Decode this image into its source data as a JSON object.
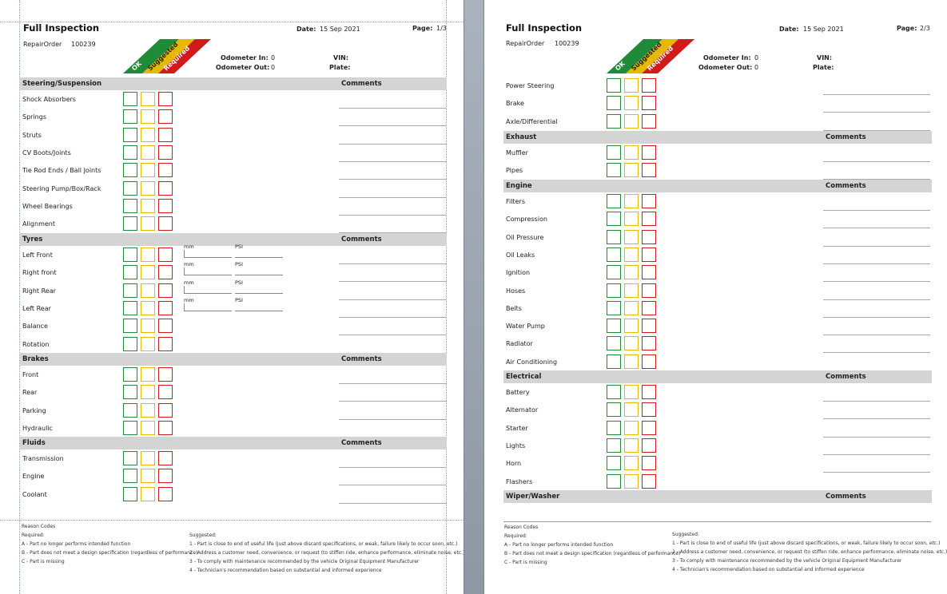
{
  "report": {
    "title": "Full Inspection",
    "repair_label": "RepairOrder",
    "repair_no": "100239",
    "date_label": "Date:",
    "date": "15 Sep 2021",
    "page_label": "Page:",
    "odo_in_label": "Odometer In:",
    "odo_in": "0",
    "odo_out_label": "Odometer Out:",
    "odo_out": "0",
    "vin_label": "VIN:",
    "plate_label": "Plate:",
    "legend": {
      "ok": "OK",
      "suggested": "Suggested",
      "required": "Required"
    },
    "comments_label": "Comments",
    "mm_label": "mm",
    "psi_label": "PSI"
  },
  "colors": {
    "ok": "#1f8a38",
    "suggested": "#e7b800",
    "required": "#d11a1a",
    "section_bg": "#d4d4d4"
  },
  "page1": {
    "page_no": "1/3",
    "sections": [
      {
        "name": "Steering/Suspension",
        "items": [
          "Shock Absorbers",
          "Springs",
          "Struts",
          "CV Boots/Joints",
          "Tie Rod Ends / Ball Joints",
          "Steering Pump/Box/Rack",
          "Wheel Bearings",
          "Alignment"
        ]
      },
      {
        "name": "Tyres",
        "items": [
          "Left Front",
          "Right front",
          "Right Rear",
          "Left Rear",
          "Balance",
          "Rotation"
        ]
      },
      {
        "name": "Brakes",
        "items": [
          "Front",
          "Rear",
          "Parking",
          "Hydraulic"
        ]
      },
      {
        "name": "Fluids",
        "items": [
          "Transmission",
          "Engine",
          "Coolant"
        ]
      }
    ]
  },
  "page2": {
    "page_no": "2/3",
    "lead_items": [
      "Power Steering",
      "Brake",
      "Axle/Differential"
    ],
    "sections": [
      {
        "name": "Exhaust",
        "items": [
          "Muffler",
          "Pipes"
        ]
      },
      {
        "name": "Engine",
        "items": [
          "Filters",
          "Compression",
          "Oil Pressure",
          "Oil Leaks",
          "Ignition",
          "Hoses",
          "Belts",
          "Water Pump",
          "Radiator",
          "Air Conditioning"
        ]
      },
      {
        "name": "Electrical",
        "items": [
          "Battery",
          "Alternator",
          "Starter",
          "Lights",
          "Horn",
          "Flashers"
        ]
      },
      {
        "name": "Wiper/Washer",
        "items": []
      }
    ]
  },
  "footer": {
    "reason_codes": "Reason Codes",
    "required": "Required:",
    "a": "A - Part no longer performs intended function",
    "b": "B - Part does not meet a design specification (regardless of performance)",
    "c": "C - Part is missing",
    "suggested": "Suggested:",
    "s1": "1 - Part is close to end of useful life (just above discard specifications, or weak, failure likely to occur soon, etc.)",
    "s2": "2 - Address a customer need, convenience, or request (to stiffen ride, enhance performance, eliminate noise, etc.)",
    "s3": "3 - To comply with maintenance recommended by the vehicle Original Equipment Manufacturer",
    "s4": "4 - Technician's recommendation based on substantial and informed experience"
  }
}
